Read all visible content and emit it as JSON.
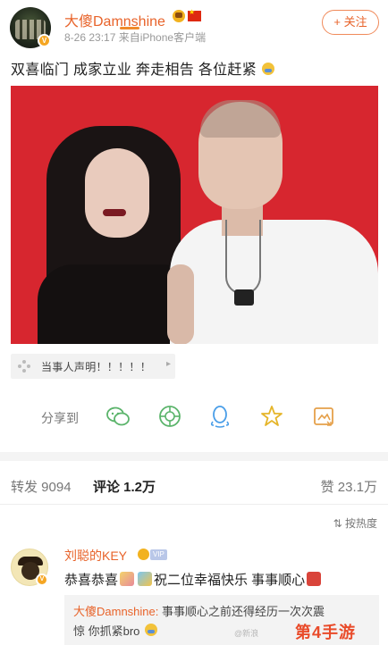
{
  "post": {
    "username": "大傻Damnshine",
    "meta": "8-26 23:17  来自iPhone客户端",
    "follow_label": "+ 关注",
    "text": "双喜临门 成家立业 奔走相告 各位赶紧",
    "reference_card": "当事人声明！！！！！"
  },
  "share": {
    "label": "分享到",
    "targets": [
      "wechat-icon",
      "moments-icon",
      "qq-icon",
      "qzone-icon",
      "save-image-icon"
    ]
  },
  "stats": {
    "repost": "转发 9094",
    "comment": "评论 1.2万",
    "like": "赞 23.1万"
  },
  "sort": {
    "label": "按热度"
  },
  "comment": {
    "username": "刘聪的KEY",
    "vip_tag": "VIP",
    "text_a": "恭喜恭喜",
    "text_b": "祝二位幸福快乐 事事顺心",
    "reply_user": "大傻Damnshine:",
    "reply_line1": " 事事顺心之前还得经历一次次震",
    "reply_line2": "惊 你抓紧bro"
  },
  "watermark": {
    "text": "第4手游",
    "small": "@新浪"
  },
  "colors": {
    "accent": "#e8632a",
    "photo_bg": "#d7262f",
    "badge": "#f5a623"
  }
}
